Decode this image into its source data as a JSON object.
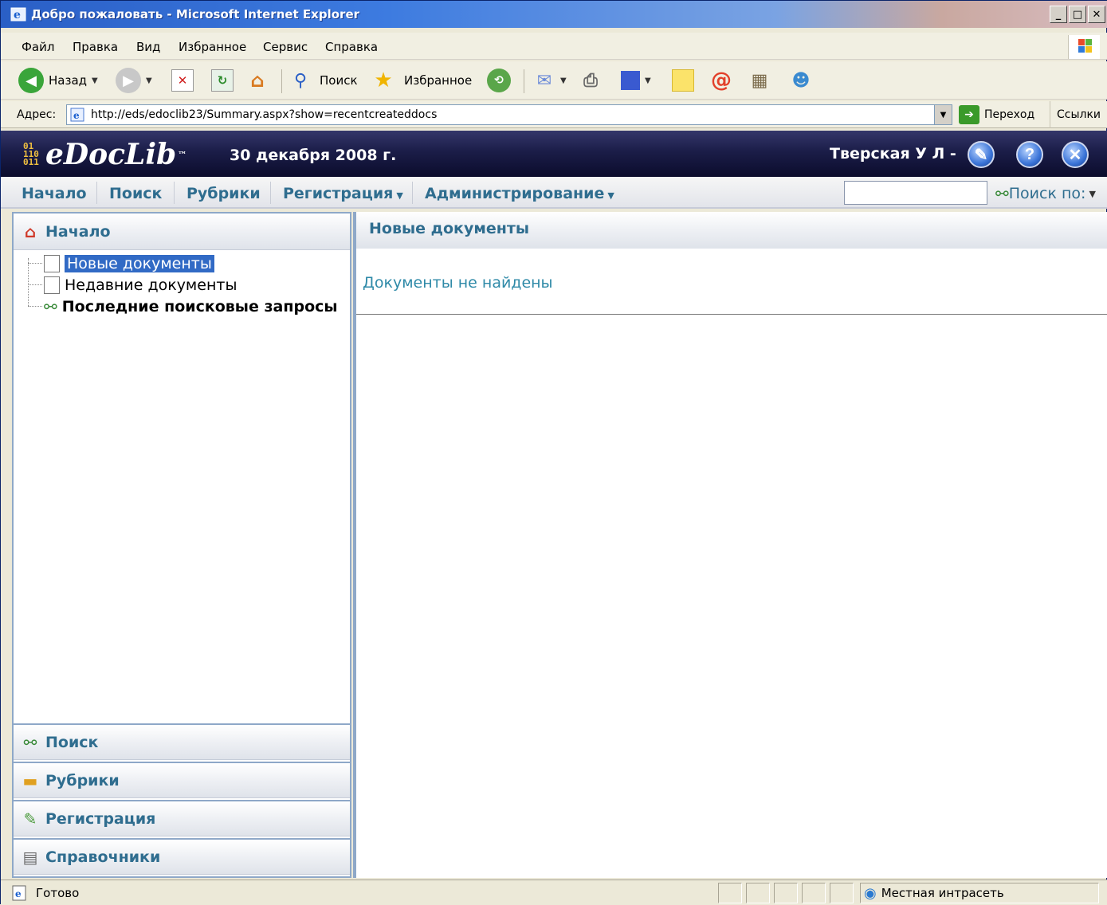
{
  "window": {
    "title": "Добро пожаловать - Microsoft Internet Explorer",
    "minimize": "_",
    "maximize": "□",
    "close": "✕"
  },
  "menu": {
    "file": "Файл",
    "edit": "Правка",
    "view": "Вид",
    "favorites": "Избранное",
    "tools": "Сервис",
    "help": "Справка"
  },
  "toolbar": {
    "back_label": "Назад",
    "search_label": "Поиск",
    "favorites_label": "Избранное"
  },
  "address": {
    "label": "Адрес:",
    "url": "http://eds/edoclib23/Summary.aspx?show=recentcreateddocs",
    "go_label": "Переход",
    "links_label": "Ссылки"
  },
  "app": {
    "logo": "eDocLib",
    "logo_tm": "™",
    "logo_bits": "01 110 011",
    "date": "30 декабря 2008 г.",
    "user": "Тверская У Л -"
  },
  "nav": {
    "home": "Начало",
    "search": "Поиск",
    "rubrics": "Рубрики",
    "registration": "Регистрация",
    "admin": "Администрирование",
    "search_by": "Поиск по:"
  },
  "left_panel": {
    "header": "Начало",
    "tree": [
      {
        "label": "Новые документы"
      },
      {
        "label": "Недавние документы"
      },
      {
        "label": "Последние поисковые запросы"
      }
    ],
    "sections": {
      "search": "Поиск",
      "rubrics": "Рубрики",
      "registration": "Регистрация",
      "references": "Справочники"
    }
  },
  "main": {
    "header": "Новые документы",
    "empty_message": "Документы не найдены"
  },
  "statusbar": {
    "status": "Готово",
    "zone": "Местная интрасеть"
  },
  "colors": {
    "accent": "#2f6d8f",
    "header_bg": "#1b1d48",
    "selection": "#316ac5"
  }
}
